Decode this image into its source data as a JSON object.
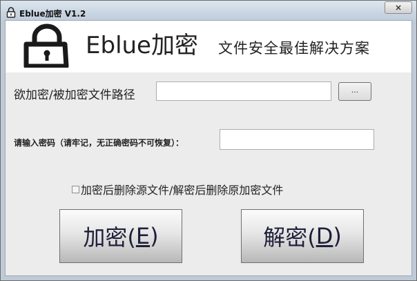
{
  "window": {
    "title": "Eblue加密 V1.2",
    "close_label": "×"
  },
  "header": {
    "app_name": "Eblue加密",
    "slogan": "文件安全最佳解决方案"
  },
  "form": {
    "path_label": "欲加密/被加密文件路径",
    "path_value": "",
    "browse_label": "...",
    "password_label": "请输入密码（请牢记，无正确密码不可恢复）：",
    "password_value": "",
    "delete_option_label": "加密后删除源文件/解密后删除原加密文件",
    "delete_option_checked": false
  },
  "actions": {
    "encrypt": {
      "text": "加密(",
      "key": "E",
      "close": ")"
    },
    "decrypt": {
      "text": "解密(",
      "key": "D",
      "close": ")"
    }
  }
}
